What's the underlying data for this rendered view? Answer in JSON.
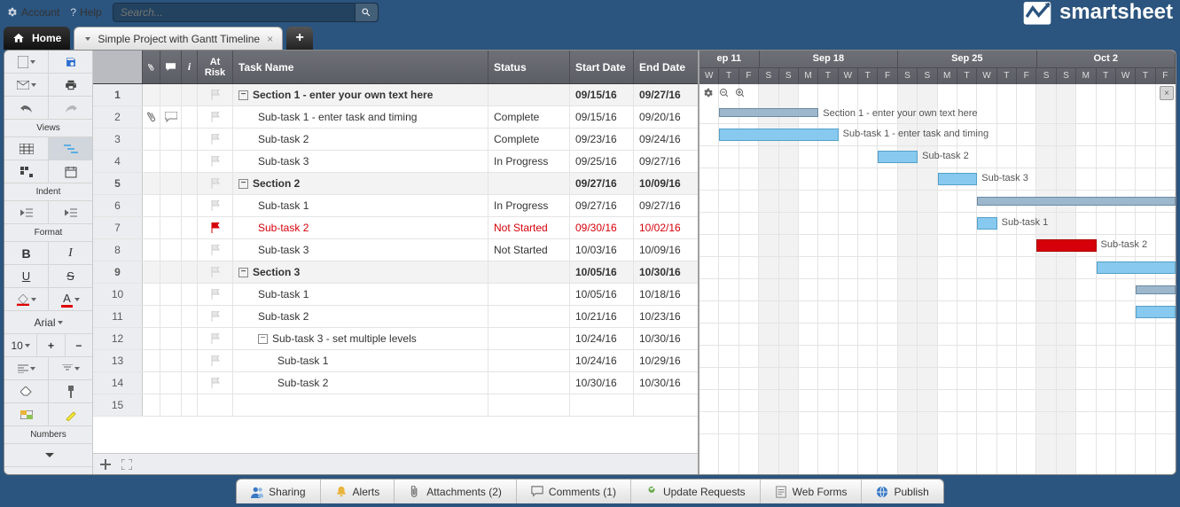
{
  "top": {
    "account": "Account",
    "help": "Help",
    "search_placeholder": "Search...",
    "brand": "smartsheet"
  },
  "tabs": {
    "home": "Home",
    "doc": "Simple Project with Gantt Timeline"
  },
  "toolbar": {
    "views": "Views",
    "indent": "Indent",
    "format": "Format",
    "font": "Arial",
    "size": "10",
    "numbers": "Numbers"
  },
  "grid": {
    "headers": {
      "atrisk": "At Risk",
      "task": "Task Name",
      "status": "Status",
      "start": "Start Date",
      "end": "End Date"
    },
    "rows": [
      {
        "n": "1",
        "section": true,
        "task": "Section 1 - enter your own text here",
        "status": "",
        "start": "09/15/16",
        "end": "09/27/16",
        "ind": 0
      },
      {
        "n": "2",
        "task": "Sub-task 1 - enter task and timing",
        "status": "Complete",
        "start": "09/15/16",
        "end": "09/20/16",
        "ind": 1,
        "att": true,
        "cm": true
      },
      {
        "n": "3",
        "task": "Sub-task 2",
        "status": "Complete",
        "start": "09/23/16",
        "end": "09/24/16",
        "ind": 1
      },
      {
        "n": "4",
        "task": "Sub-task 3",
        "status": "In Progress",
        "start": "09/25/16",
        "end": "09/27/16",
        "ind": 1
      },
      {
        "n": "5",
        "section": true,
        "task": "Section 2",
        "status": "",
        "start": "09/27/16",
        "end": "10/09/16",
        "ind": 0
      },
      {
        "n": "6",
        "task": "Sub-task 1",
        "status": "In Progress",
        "start": "09/27/16",
        "end": "09/27/16",
        "ind": 1
      },
      {
        "n": "7",
        "task": "Sub-task 2",
        "status": "Not Started",
        "start": "09/30/16",
        "end": "10/02/16",
        "ind": 1,
        "atrisk": true
      },
      {
        "n": "8",
        "task": "Sub-task 3",
        "status": "Not Started",
        "start": "10/03/16",
        "end": "10/09/16",
        "ind": 1
      },
      {
        "n": "9",
        "section": true,
        "task": "Section 3",
        "status": "",
        "start": "10/05/16",
        "end": "10/30/16",
        "ind": 0
      },
      {
        "n": "10",
        "task": "Sub-task 1",
        "status": "",
        "start": "10/05/16",
        "end": "10/18/16",
        "ind": 1
      },
      {
        "n": "11",
        "task": "Sub-task 2",
        "status": "",
        "start": "10/21/16",
        "end": "10/23/16",
        "ind": 1
      },
      {
        "n": "12",
        "task": "Sub-task 3 - set multiple levels",
        "status": "",
        "start": "10/24/16",
        "end": "10/30/16",
        "ind": 1,
        "exp": true
      },
      {
        "n": "13",
        "task": "Sub-task 1",
        "status": "",
        "start": "10/24/16",
        "end": "10/29/16",
        "ind": 2
      },
      {
        "n": "14",
        "task": "Sub-task 2",
        "status": "",
        "start": "10/30/16",
        "end": "10/30/16",
        "ind": 2
      },
      {
        "n": "15",
        "task": "",
        "status": "",
        "start": "",
        "end": "",
        "ind": 0,
        "empty": true
      }
    ]
  },
  "gantt": {
    "weeks": [
      "ep 11",
      "Sep 18",
      "Sep 25",
      "Oct 2"
    ],
    "days": [
      "W",
      "T",
      "F",
      "S",
      "S",
      "M",
      "T",
      "W",
      "T",
      "F",
      "S",
      "S",
      "M",
      "T",
      "W",
      "T",
      "F",
      "S",
      "S",
      "M",
      "T",
      "W",
      "T",
      "F"
    ],
    "wkend_idx": [
      3,
      4,
      10,
      11,
      17,
      18
    ],
    "bars": [
      {
        "row": 0,
        "from": 1,
        "to": 6,
        "summary": true,
        "label": "Section 1 - enter your own text here"
      },
      {
        "row": 1,
        "from": 1,
        "to": 7,
        "label": "Sub-task 1 - enter task and timing"
      },
      {
        "row": 2,
        "from": 9,
        "to": 11,
        "label": "Sub-task 2"
      },
      {
        "row": 3,
        "from": 12,
        "to": 14,
        "label": "Sub-task 3"
      },
      {
        "row": 4,
        "from": 14,
        "to": 24,
        "summary": true,
        "nolabel": true
      },
      {
        "row": 5,
        "from": 14,
        "to": 15,
        "label": "Sub-task 1"
      },
      {
        "row": 6,
        "from": 17,
        "to": 20,
        "label": "Sub-task 2",
        "red": true
      },
      {
        "row": 7,
        "from": 20,
        "to": 24,
        "nolabel": true
      },
      {
        "row": 8,
        "from": 22,
        "to": 24,
        "summary": true,
        "nolabel": true
      },
      {
        "row": 9,
        "from": 22,
        "to": 24,
        "nolabel": true
      }
    ]
  },
  "bottom": {
    "sharing": "Sharing",
    "alerts": "Alerts",
    "attachments": "Attachments  (2)",
    "comments": "Comments  (1)",
    "update": "Update Requests",
    "webforms": "Web Forms",
    "publish": "Publish"
  }
}
